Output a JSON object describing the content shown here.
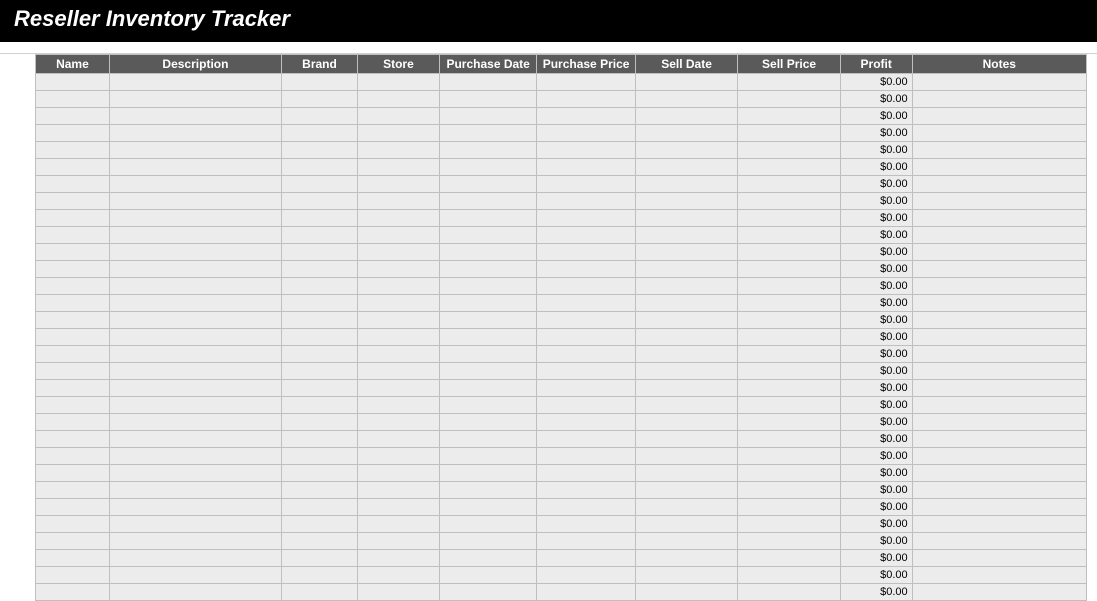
{
  "title": "Reseller Inventory Tracker",
  "columns": [
    "Name",
    "Description",
    "Brand",
    "Store",
    "Purchase Date",
    "Purchase Price",
    "Sell Date",
    "Sell Price",
    "Profit",
    "Notes"
  ],
  "rows": [
    {
      "name": "",
      "description": "",
      "brand": "",
      "store": "",
      "purchase_date": "",
      "purchase_price": "",
      "sell_date": "",
      "sell_price": "",
      "profit": "$0.00",
      "notes": ""
    },
    {
      "name": "",
      "description": "",
      "brand": "",
      "store": "",
      "purchase_date": "",
      "purchase_price": "",
      "sell_date": "",
      "sell_price": "",
      "profit": "$0.00",
      "notes": ""
    },
    {
      "name": "",
      "description": "",
      "brand": "",
      "store": "",
      "purchase_date": "",
      "purchase_price": "",
      "sell_date": "",
      "sell_price": "",
      "profit": "$0.00",
      "notes": ""
    },
    {
      "name": "",
      "description": "",
      "brand": "",
      "store": "",
      "purchase_date": "",
      "purchase_price": "",
      "sell_date": "",
      "sell_price": "",
      "profit": "$0.00",
      "notes": ""
    },
    {
      "name": "",
      "description": "",
      "brand": "",
      "store": "",
      "purchase_date": "",
      "purchase_price": "",
      "sell_date": "",
      "sell_price": "",
      "profit": "$0.00",
      "notes": ""
    },
    {
      "name": "",
      "description": "",
      "brand": "",
      "store": "",
      "purchase_date": "",
      "purchase_price": "",
      "sell_date": "",
      "sell_price": "",
      "profit": "$0.00",
      "notes": ""
    },
    {
      "name": "",
      "description": "",
      "brand": "",
      "store": "",
      "purchase_date": "",
      "purchase_price": "",
      "sell_date": "",
      "sell_price": "",
      "profit": "$0.00",
      "notes": ""
    },
    {
      "name": "",
      "description": "",
      "brand": "",
      "store": "",
      "purchase_date": "",
      "purchase_price": "",
      "sell_date": "",
      "sell_price": "",
      "profit": "$0.00",
      "notes": ""
    },
    {
      "name": "",
      "description": "",
      "brand": "",
      "store": "",
      "purchase_date": "",
      "purchase_price": "",
      "sell_date": "",
      "sell_price": "",
      "profit": "$0.00",
      "notes": ""
    },
    {
      "name": "",
      "description": "",
      "brand": "",
      "store": "",
      "purchase_date": "",
      "purchase_price": "",
      "sell_date": "",
      "sell_price": "",
      "profit": "$0.00",
      "notes": ""
    },
    {
      "name": "",
      "description": "",
      "brand": "",
      "store": "",
      "purchase_date": "",
      "purchase_price": "",
      "sell_date": "",
      "sell_price": "",
      "profit": "$0.00",
      "notes": ""
    },
    {
      "name": "",
      "description": "",
      "brand": "",
      "store": "",
      "purchase_date": "",
      "purchase_price": "",
      "sell_date": "",
      "sell_price": "",
      "profit": "$0.00",
      "notes": ""
    },
    {
      "name": "",
      "description": "",
      "brand": "",
      "store": "",
      "purchase_date": "",
      "purchase_price": "",
      "sell_date": "",
      "sell_price": "",
      "profit": "$0.00",
      "notes": ""
    },
    {
      "name": "",
      "description": "",
      "brand": "",
      "store": "",
      "purchase_date": "",
      "purchase_price": "",
      "sell_date": "",
      "sell_price": "",
      "profit": "$0.00",
      "notes": ""
    },
    {
      "name": "",
      "description": "",
      "brand": "",
      "store": "",
      "purchase_date": "",
      "purchase_price": "",
      "sell_date": "",
      "sell_price": "",
      "profit": "$0.00",
      "notes": ""
    },
    {
      "name": "",
      "description": "",
      "brand": "",
      "store": "",
      "purchase_date": "",
      "purchase_price": "",
      "sell_date": "",
      "sell_price": "",
      "profit": "$0.00",
      "notes": ""
    },
    {
      "name": "",
      "description": "",
      "brand": "",
      "store": "",
      "purchase_date": "",
      "purchase_price": "",
      "sell_date": "",
      "sell_price": "",
      "profit": "$0.00",
      "notes": ""
    },
    {
      "name": "",
      "description": "",
      "brand": "",
      "store": "",
      "purchase_date": "",
      "purchase_price": "",
      "sell_date": "",
      "sell_price": "",
      "profit": "$0.00",
      "notes": ""
    },
    {
      "name": "",
      "description": "",
      "brand": "",
      "store": "",
      "purchase_date": "",
      "purchase_price": "",
      "sell_date": "",
      "sell_price": "",
      "profit": "$0.00",
      "notes": ""
    },
    {
      "name": "",
      "description": "",
      "brand": "",
      "store": "",
      "purchase_date": "",
      "purchase_price": "",
      "sell_date": "",
      "sell_price": "",
      "profit": "$0.00",
      "notes": ""
    },
    {
      "name": "",
      "description": "",
      "brand": "",
      "store": "",
      "purchase_date": "",
      "purchase_price": "",
      "sell_date": "",
      "sell_price": "",
      "profit": "$0.00",
      "notes": ""
    },
    {
      "name": "",
      "description": "",
      "brand": "",
      "store": "",
      "purchase_date": "",
      "purchase_price": "",
      "sell_date": "",
      "sell_price": "",
      "profit": "$0.00",
      "notes": ""
    },
    {
      "name": "",
      "description": "",
      "brand": "",
      "store": "",
      "purchase_date": "",
      "purchase_price": "",
      "sell_date": "",
      "sell_price": "",
      "profit": "$0.00",
      "notes": ""
    },
    {
      "name": "",
      "description": "",
      "brand": "",
      "store": "",
      "purchase_date": "",
      "purchase_price": "",
      "sell_date": "",
      "sell_price": "",
      "profit": "$0.00",
      "notes": ""
    },
    {
      "name": "",
      "description": "",
      "brand": "",
      "store": "",
      "purchase_date": "",
      "purchase_price": "",
      "sell_date": "",
      "sell_price": "",
      "profit": "$0.00",
      "notes": ""
    },
    {
      "name": "",
      "description": "",
      "brand": "",
      "store": "",
      "purchase_date": "",
      "purchase_price": "",
      "sell_date": "",
      "sell_price": "",
      "profit": "$0.00",
      "notes": ""
    },
    {
      "name": "",
      "description": "",
      "brand": "",
      "store": "",
      "purchase_date": "",
      "purchase_price": "",
      "sell_date": "",
      "sell_price": "",
      "profit": "$0.00",
      "notes": ""
    },
    {
      "name": "",
      "description": "",
      "brand": "",
      "store": "",
      "purchase_date": "",
      "purchase_price": "",
      "sell_date": "",
      "sell_price": "",
      "profit": "$0.00",
      "notes": ""
    },
    {
      "name": "",
      "description": "",
      "brand": "",
      "store": "",
      "purchase_date": "",
      "purchase_price": "",
      "sell_date": "",
      "sell_price": "",
      "profit": "$0.00",
      "notes": ""
    },
    {
      "name": "",
      "description": "",
      "brand": "",
      "store": "",
      "purchase_date": "",
      "purchase_price": "",
      "sell_date": "",
      "sell_price": "",
      "profit": "$0.00",
      "notes": ""
    },
    {
      "name": "",
      "description": "",
      "brand": "",
      "store": "",
      "purchase_date": "",
      "purchase_price": "",
      "sell_date": "",
      "sell_price": "",
      "profit": "$0.00",
      "notes": ""
    }
  ]
}
